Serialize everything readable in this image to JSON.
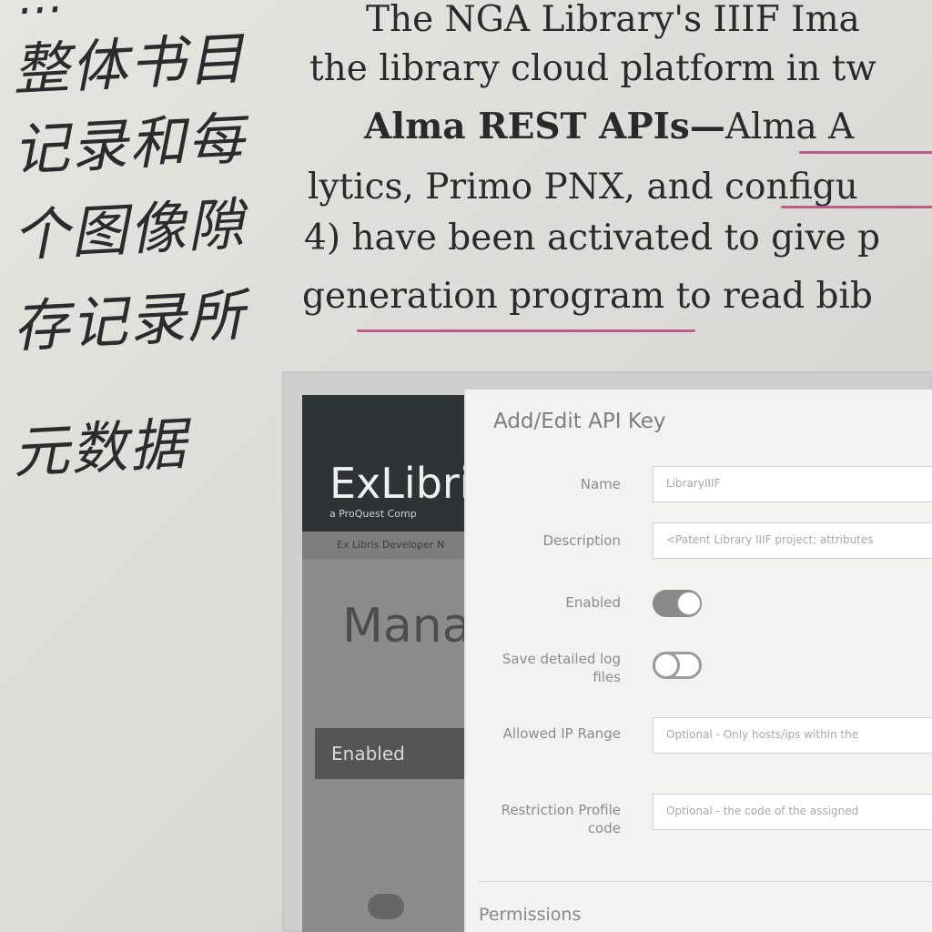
{
  "handwriting": {
    "line1": "…",
    "line2": "整体书目",
    "line3": "记录和每",
    "line4": "个图像隙",
    "line5": "存记录所",
    "line6": "元数据"
  },
  "book": {
    "line1": "The NGA Library's IIIF Ima",
    "line2": "the library cloud platform in tw",
    "line3_bold": "Alma REST APIs—",
    "line3_rest": "Alma A",
    "line4": "lytics, Primo PNX, and configu",
    "line5": "4) have been activated to give p",
    "line6": "generation program to read bib"
  },
  "figure": {
    "logo": "ExLibri",
    "logo_sub": "a ProQuest Comp",
    "nav_text": "Ex Libris Developer N",
    "manage": "Mana",
    "enabled_bar": "Enabled",
    "dialog": {
      "title": "Add/Edit API Key",
      "name_label": "Name",
      "name_value": "LibraryIIIF",
      "description_label": "Description",
      "description_value": "<Patent Library IIIF project; attributes",
      "enabled_label": "Enabled",
      "save_logs_label": "Save detailed log files",
      "ip_label": "Allowed IP Range",
      "ip_placeholder": "Optional - Only hosts/ips within the",
      "restriction_label": "Restriction Profile code",
      "restriction_placeholder": "Optional - the code of the assigned",
      "permissions_label": "Permissions",
      "enabled_on": true,
      "save_logs_on": false
    }
  },
  "colors": {
    "underline": "#b5477a",
    "page": "#e4e2de",
    "ink": "#2a2a2c"
  }
}
